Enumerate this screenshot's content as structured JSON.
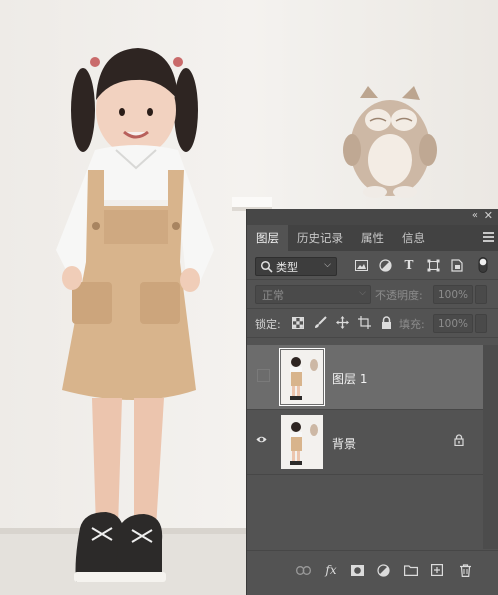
{
  "panel": {
    "collapse_glyph": "«",
    "close_glyph": "✕",
    "tabs": [
      {
        "label": "图层",
        "active": true
      },
      {
        "label": "历史记录",
        "active": false
      },
      {
        "label": "属性",
        "active": false
      },
      {
        "label": "信息",
        "active": false
      }
    ],
    "filter": {
      "kind_label": "类型",
      "icons": [
        "image-filter-icon",
        "adjustment-filter-icon",
        "type-filter-icon",
        "shape-filter-icon",
        "smart-object-filter-icon",
        "filter-toggle-icon"
      ]
    },
    "blend": {
      "mode": "正常",
      "opacity_label": "不透明度:",
      "opacity_value": "100%"
    },
    "lock": {
      "label": "锁定:",
      "icons": [
        "lock-transparent-pixels-icon",
        "lock-image-pixels-icon",
        "lock-position-icon",
        "lock-artboard-icon",
        "lock-all-icon"
      ],
      "fill_label": "填充:",
      "fill_value": "100%"
    },
    "layers": [
      {
        "name": "图层 1",
        "visible": false,
        "selected": true,
        "locked": false
      },
      {
        "name": "背景",
        "visible": true,
        "selected": false,
        "locked": true
      }
    ],
    "bottom_icons": [
      "link-layers-icon",
      "fx-icon",
      "add-mask-icon",
      "new-adjustment-layer-icon",
      "new-group-icon",
      "new-layer-icon",
      "delete-layer-icon"
    ],
    "fx_label": "fx"
  },
  "colors": {
    "panel_bg": "#535353",
    "tab_bar_bg": "#424242",
    "selected_layer_bg": "#6c6c6c",
    "photo_wall": "#f1efec"
  }
}
